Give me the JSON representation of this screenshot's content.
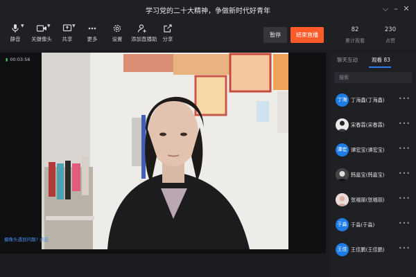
{
  "window": {
    "title": "学习党的二十大精神，争做新时代好青年"
  },
  "toolbar": {
    "items": [
      {
        "label": "静音",
        "icon": "microphone-icon"
      },
      {
        "label": "关摄像头",
        "icon": "camera-icon"
      },
      {
        "label": "共享",
        "icon": "screen-share-icon"
      },
      {
        "label": "更多",
        "icon": "more-dots-icon"
      },
      {
        "label": "设置",
        "icon": "gear-icon"
      },
      {
        "label": "添加直播助",
        "icon": "add-assistant-icon"
      },
      {
        "label": "分享",
        "icon": "share-icon"
      }
    ],
    "pause_label": "暂停",
    "end_label": "结束直播"
  },
  "stats": {
    "total_views": {
      "value": "82",
      "caption": "累计观看"
    },
    "likes": {
      "value": "230",
      "caption": "点赞"
    }
  },
  "video": {
    "timer": "00:03:56",
    "camera_tip": "摄像头遇到问题? 点击",
    "ui_colors": {
      "accent_blue": "#2e7cf6",
      "end_orange": "#ff5a28",
      "signal_green": "#3ecf6a"
    }
  },
  "sidebar": {
    "tabs": [
      {
        "label": "聊天互动"
      },
      {
        "label": "观看 83"
      }
    ],
    "search_placeholder": "搜索",
    "viewers": [
      {
        "avatar_text": "丁海",
        "name": "丁海鑫(丁海鑫)",
        "avatar_type": "text"
      },
      {
        "avatar_text": "",
        "name": "宋春霖(宋春霖)",
        "avatar_type": "photo"
      },
      {
        "avatar_text": "谭宏",
        "name": "谭宏宝(谭宏宝)",
        "avatar_type": "text"
      },
      {
        "avatar_text": "",
        "name": "韩嘉宝(韩嘉宝)",
        "avatar_type": "photo"
      },
      {
        "avatar_text": "",
        "name": "张福丽(张福丽)",
        "avatar_type": "photo"
      },
      {
        "avatar_text": "于淼",
        "name": "于淼(于淼)",
        "avatar_type": "text"
      },
      {
        "avatar_text": "王佳",
        "name": "王佳鹏(王佳鹏)",
        "avatar_type": "text"
      }
    ]
  }
}
